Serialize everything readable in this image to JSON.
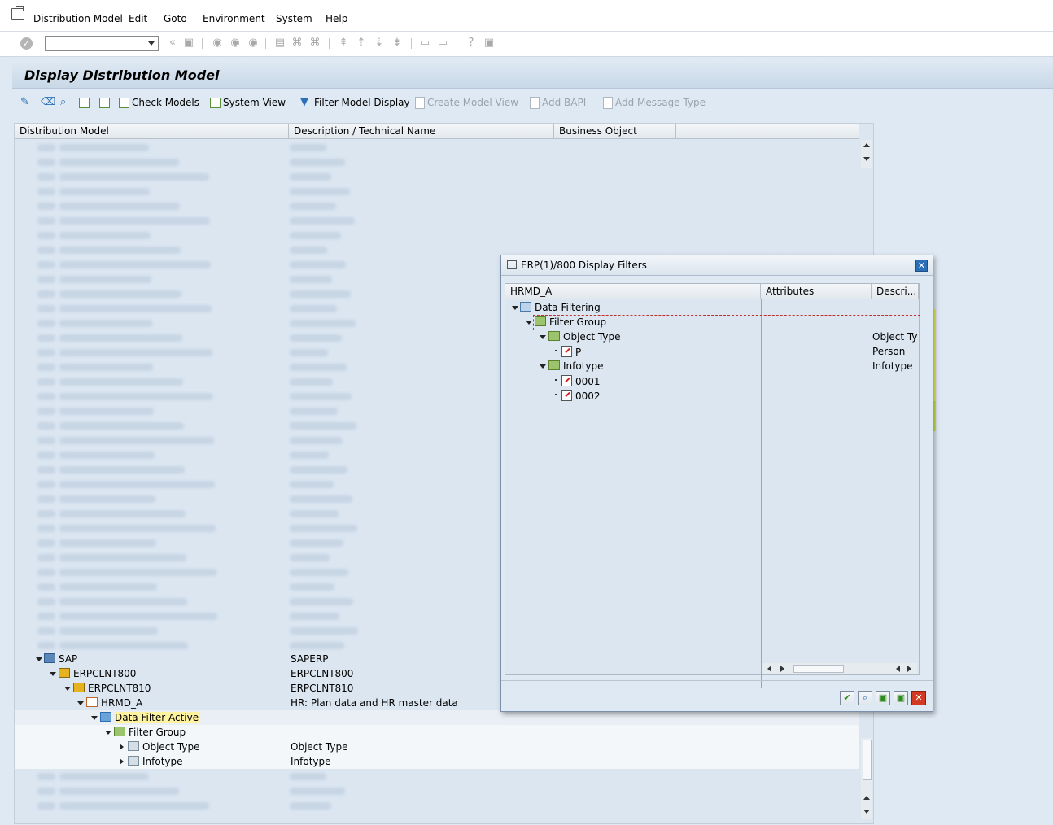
{
  "menubar": {
    "items": [
      "Distribution Model",
      "Edit",
      "Goto",
      "Environment",
      "System",
      "Help"
    ]
  },
  "page": {
    "title": "Display Distribution Model"
  },
  "app_toolbar": {
    "check_models": "Check Models",
    "system_view": "System View",
    "filter_model_display": "Filter Model Display",
    "create_model_view": "Create Model View",
    "add_bapi": "Add BAPI",
    "add_message_type": "Add Message Type"
  },
  "grid": {
    "columns": [
      "Distribution Model",
      "Description / Technical Name",
      "Business Object"
    ],
    "tree_rows": [
      {
        "label": "SAP",
        "desc": "SAPERP"
      },
      {
        "label": "ERPCLNT800",
        "desc": "ERPCLNT800"
      },
      {
        "label": "ERPCLNT810",
        "desc": "ERPCLNT810"
      },
      {
        "label": "HRMD_A",
        "desc": "HR: Plan data and HR master data"
      },
      {
        "label": "Data Filter Active",
        "desc": ""
      },
      {
        "label": "Filter Group",
        "desc": ""
      },
      {
        "label": "Object Type",
        "desc": "Object Type"
      },
      {
        "label": "Infotype",
        "desc": "Infotype"
      }
    ]
  },
  "dialog": {
    "title": "ERP(1)/800 Display Filters",
    "columns": [
      "HRMD_A",
      "Attributes",
      "Descri..."
    ],
    "rows": [
      {
        "label": "Data Filtering",
        "desc": ""
      },
      {
        "label": "Filter Group",
        "desc": ""
      },
      {
        "label": "Object Type",
        "desc": "Object Ty"
      },
      {
        "label": "P",
        "desc": "Person"
      },
      {
        "label": "Infotype",
        "desc": "Infotype"
      },
      {
        "label": "0001",
        "desc": ""
      },
      {
        "label": "0002",
        "desc": ""
      }
    ]
  },
  "colors": {
    "highlight": "#e8f332",
    "title_bg": "#dce7f1",
    "accent": "#2d6fb7"
  }
}
